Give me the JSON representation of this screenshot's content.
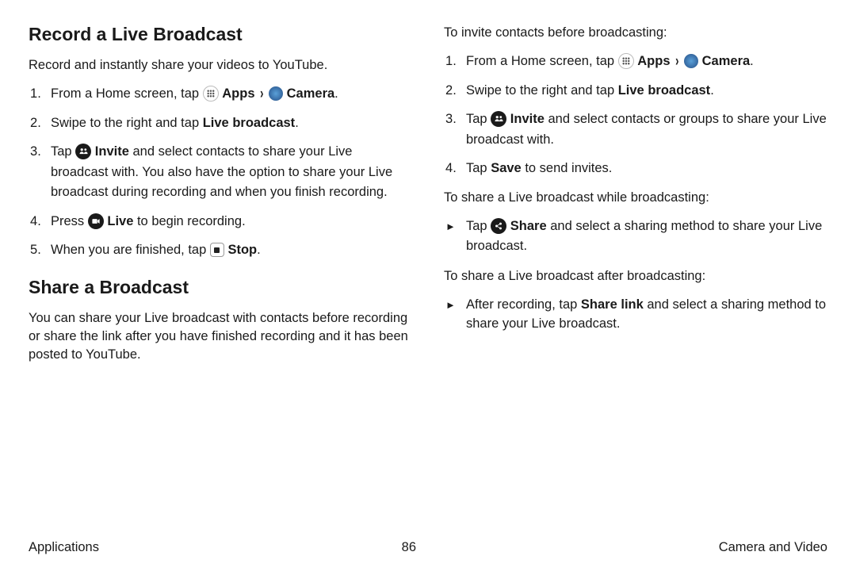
{
  "left": {
    "h1": "Record a Live Broadcast",
    "intro": "Record and instantly share your videos to YouTube.",
    "s1_a": "From a Home screen, tap ",
    "s1_apps": "Apps",
    "s1_camera": "Camera",
    "s1_dot": ".",
    "s2_a": "Swipe to the right and tap ",
    "s2_b": "Live broadcast",
    "s2_dot": ".",
    "s3_a": "Tap ",
    "s3_b": "Invite",
    "s3_c": " and select contacts to share your Live broadcast with. You also have the option to share your Live broadcast during recording and when you finish recording.",
    "s4_a": "Press ",
    "s4_b": "Live",
    "s4_c": " to begin recording.",
    "s5_a": "When you are finished, tap ",
    "s5_b": "Stop",
    "s5_dot": ".",
    "h2": "Share a Broadcast",
    "p2": "You can share your Live broadcast with contacts before recording or share the link after you have finished recording and it has been posted to YouTube."
  },
  "right": {
    "p1": "To invite contacts before broadcasting:",
    "s1_a": "From a Home screen, tap ",
    "s1_apps": "Apps",
    "s1_camera": "Camera",
    "s1_dot": ".",
    "s2_a": "Swipe to the right and tap ",
    "s2_b": "Live broadcast",
    "s2_dot": ".",
    "s3_a": "Tap ",
    "s3_b": "Invite",
    "s3_c": " and select contacts or groups to share your Live broadcast with.",
    "s4_a": "Tap ",
    "s4_b": "Save",
    "s4_c": " to send invites.",
    "p2": "To share a Live broadcast while broadcasting:",
    "a1_a": "Tap ",
    "a1_b": "Share",
    "a1_c": " and select a sharing method to share your Live broadcast.",
    "p3": "To share a Live broadcast after broadcasting:",
    "a2_a": "After recording, tap ",
    "a2_b": "Share link",
    "a2_c": " and select a sharing method to share your Live broadcast."
  },
  "footer": {
    "left": "Applications",
    "center": "86",
    "right": "Camera and Video"
  }
}
